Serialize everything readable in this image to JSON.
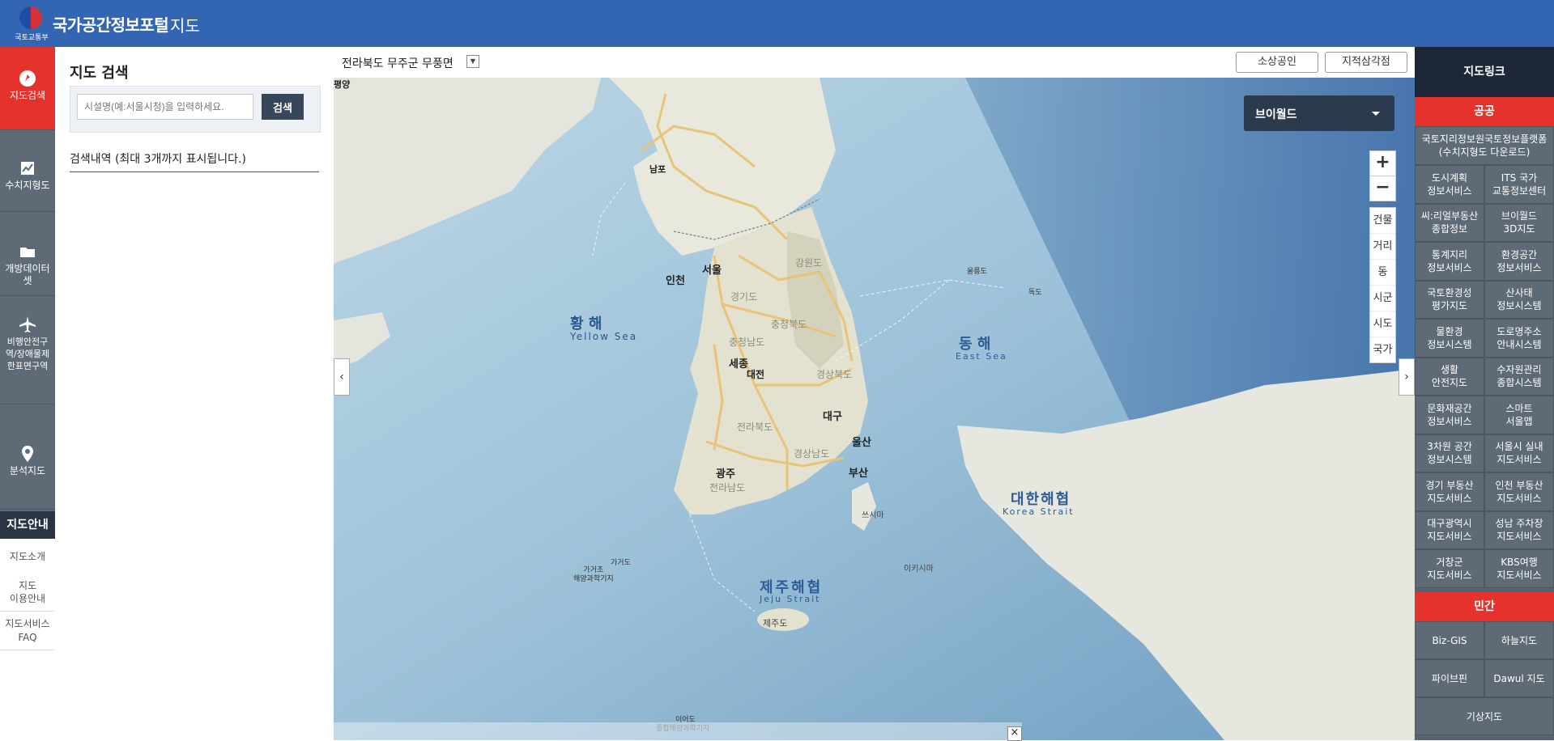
{
  "header": {
    "logo_text": "국토교통부",
    "brand": "국가공간정보포털",
    "section": "지도"
  },
  "rail": {
    "items": [
      {
        "label": "지도검색",
        "icon": "search-map-icon",
        "active": true
      },
      {
        "label": "수치지형도",
        "icon": "chart-icon"
      },
      {
        "label": "개방데이터셋",
        "icon": "folder-icon"
      },
      {
        "label": "비행안전구역/장애물제한표면구역",
        "icon": "airplane-icon"
      },
      {
        "label": "분석지도",
        "icon": "pin-icon"
      }
    ],
    "guide_title": "지도안내",
    "guide_items": [
      "지도소개",
      "지도\n이용안내",
      "지도서비스\nFAQ"
    ]
  },
  "search": {
    "title": "지도 검색",
    "placeholder": "시설명(예:서울시청)을 입력하세요.",
    "button": "검색",
    "history_label": "검색내역 (최대 3개까지 표시됩니다.)"
  },
  "mapbar": {
    "location": "전라북도 무주군 무풍면",
    "btn_small_business": "소상공인",
    "btn_cadastral": "지적삼각점"
  },
  "map": {
    "basemap": "브이월드",
    "zoom_in": "+",
    "zoom_out": "−",
    "levels": [
      "건물",
      "거리",
      "동",
      "시군",
      "시도",
      "국가"
    ],
    "labels": {
      "yellow_sea_ko": "황 해",
      "yellow_sea_en": "Yellow Sea",
      "east_sea_ko": "동 해",
      "east_sea_en": "East Sea",
      "korea_strait_ko": "대한해협",
      "korea_strait_en": "Korea Strait",
      "jeju_strait_ko": "제주해협",
      "jeju_strait_en": "Jeju Strait",
      "seoul": "서울",
      "incheon": "인천",
      "sejong": "세종",
      "daejeon": "대전",
      "daegu": "대구",
      "ulsan": "울산",
      "busan": "부산",
      "gwangju": "광주",
      "pyongyang": "평양",
      "nampo": "남포",
      "jejudo": "제주도",
      "gyeonggi": "경기도",
      "gangwon": "강원도",
      "chungbuk": "충청북도",
      "chungnam": "충청남도",
      "gyeongbuk": "경상북도",
      "jeonbuk": "전라북도",
      "jeonnam": "전라남도",
      "gyeongnam": "경상남도",
      "dokdo": "독도",
      "ulleung": "울릉도",
      "gageodo": "가거도",
      "gageodo_sci": "가거초\n해양과학기지",
      "ieodo": "이어도",
      "ieodo_sci": "종합해양과학기지",
      "tsushima": "쓰시마",
      "iki": "이키시마"
    }
  },
  "right": {
    "header": "지도링크",
    "public_label": "공공",
    "public_items": [
      "국토지리정보원국토정보플랫폼\n(수치지형도 다운로드)",
      "도시계획\n정보서비스",
      "ITS 국가\n교통정보센터",
      "씨:리얼부동산\n종합정보",
      "브이월드\n3D지도",
      "통계지리\n정보서비스",
      "환경공간\n정보서비스",
      "국토환경성\n평가지도",
      "산사태\n정보시스템",
      "물환경\n정보시스템",
      "도로명주소\n안내시스템",
      "생활\n안전지도",
      "수자원관리\n종합시스템",
      "문화재공간\n정보서비스",
      "스마트\n서울맵",
      "3차원 공간\n정보시스템",
      "서울시 실내\n지도서비스",
      "경기 부동산\n지도서비스",
      "인천 부동산\n지도서비스",
      "대구광역시\n지도서비스",
      "성남 주차장\n지도서비스",
      "거창군\n지도서비스",
      "KBS여행\n지도서비스"
    ],
    "private_label": "민간",
    "private_items": [
      "Biz-GIS",
      "하늘지도",
      "파이브핀",
      "Dawul 지도",
      "기상지도"
    ]
  },
  "colors": {
    "header_blue": "#3266b3",
    "accent_red": "#e5322c",
    "dark_navy": "#1e2736",
    "rail_gray": "#5e6a76"
  }
}
